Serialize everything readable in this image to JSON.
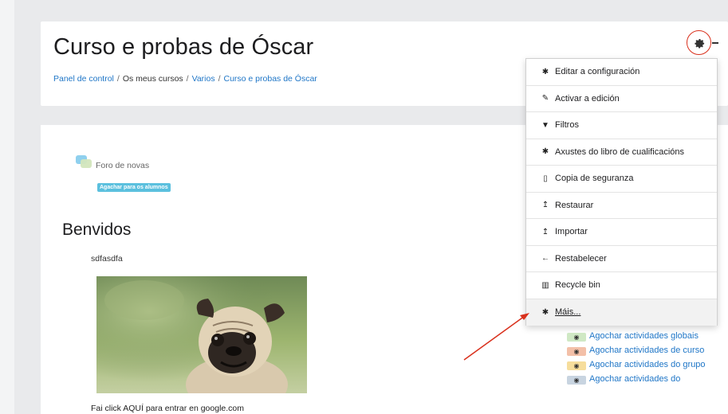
{
  "header": {
    "title": "Curso e probas de Óscar",
    "breadcrumb": [
      "Panel de control",
      "Os meus cursos",
      "Varios",
      "Curso e probas de Óscar"
    ],
    "breadcrumb_sep": "/"
  },
  "content": {
    "forum_label": "Foro de novas",
    "hidden_badge": "Agachar para os alumnos",
    "section_title": "Benvidos",
    "section_summary": "sdfasdfa",
    "caption": "Fai click AQUÍ para entrar en google.com"
  },
  "menu": {
    "items": [
      {
        "label": "Editar a configuración",
        "icon": "gear-icon"
      },
      {
        "label": "Activar a edición",
        "icon": "pencil-icon"
      },
      {
        "label": "Filtros",
        "icon": "filter-icon"
      },
      {
        "label": "Axustes do libro de cualificacións",
        "icon": "gear-icon"
      },
      {
        "label": "Copia de seguranza",
        "icon": "file-icon"
      },
      {
        "label": "Restaurar",
        "icon": "upload-icon"
      },
      {
        "label": "Importar",
        "icon": "upload-icon"
      },
      {
        "label": "Restabelecer",
        "icon": "arrow-left-icon"
      },
      {
        "label": "Recycle bin",
        "icon": "trash-icon"
      },
      {
        "label": "Máis...",
        "icon": "gear-icon"
      }
    ]
  },
  "block": {
    "links": [
      {
        "label": "Agochar actividades globais",
        "color": "#cfe8c4"
      },
      {
        "label": "Agochar actividades de curso",
        "color": "#f3c0a8"
      },
      {
        "label": "Agochar actividades do grupo",
        "color": "#f6dd9c"
      },
      {
        "label": "Agochar actividades do",
        "color": "#c8d4e0"
      }
    ]
  },
  "colors": {
    "link": "#1f76c7",
    "highlight": "#d9301c",
    "badge": "#5bc0de"
  }
}
